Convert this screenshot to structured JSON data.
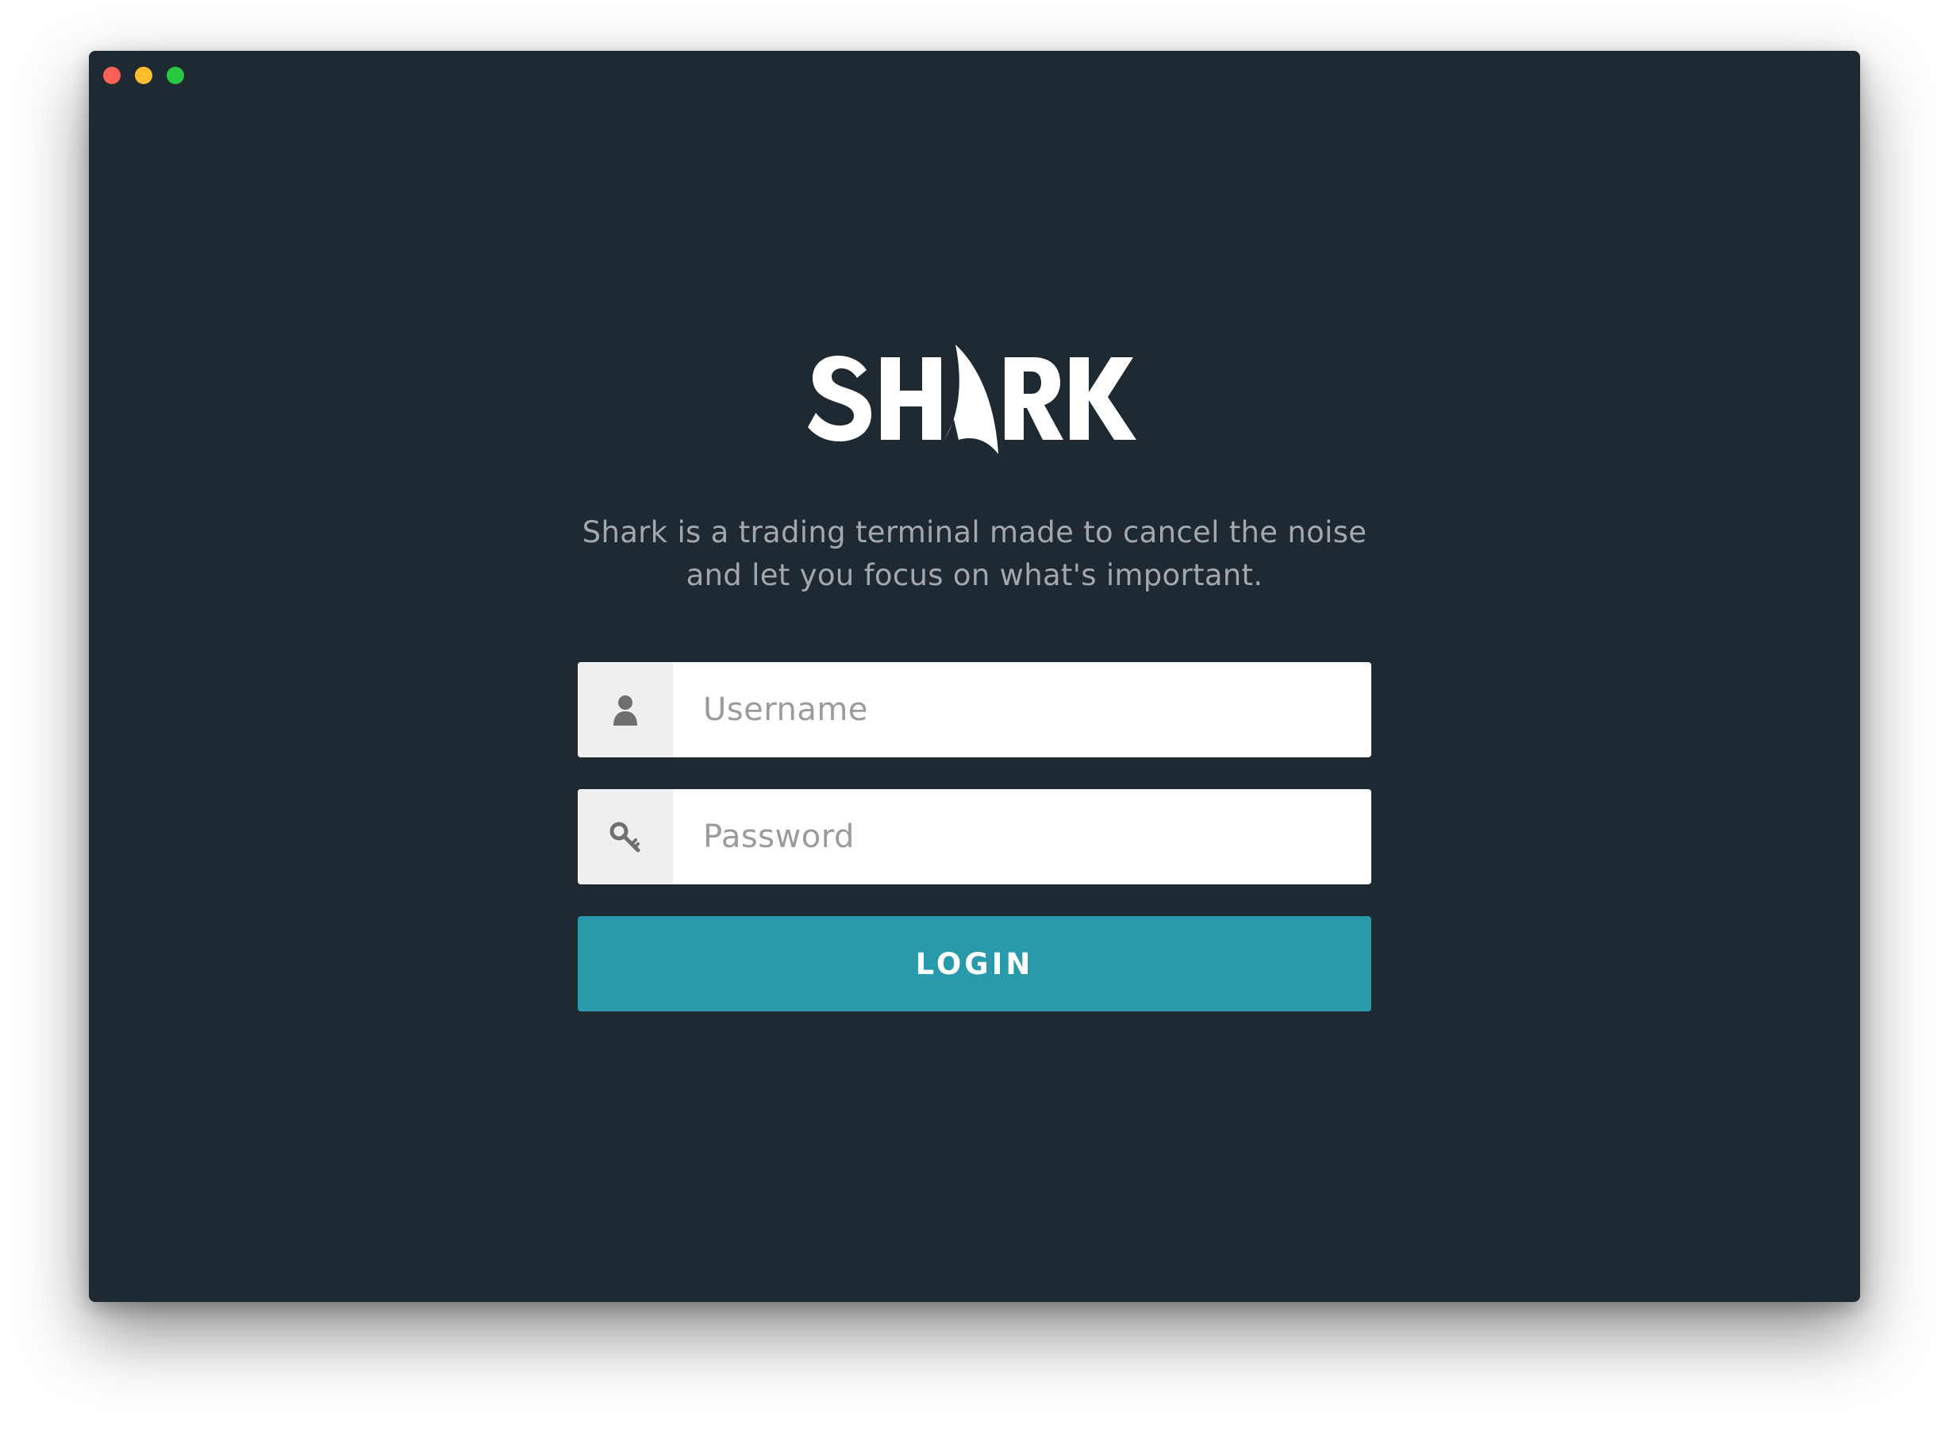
{
  "window": {
    "controls": [
      {
        "name": "close",
        "color": "#fe5f57"
      },
      {
        "name": "minimize",
        "color": "#febc2e"
      },
      {
        "name": "zoom",
        "color": "#28c840"
      }
    ]
  },
  "brand": {
    "logo_text": "SHARK",
    "logo_icon": "shark-fin-icon"
  },
  "tagline": {
    "line1": "Shark is a trading terminal made to cancel the noise",
    "line2": "and let you focus on what's important."
  },
  "form": {
    "username": {
      "value": "",
      "placeholder": "Username",
      "icon": "user-icon"
    },
    "password": {
      "value": "",
      "placeholder": "Password",
      "icon": "key-icon"
    },
    "login_label": "LOGIN"
  },
  "colors": {
    "background": "#1e2932",
    "accent": "#289aaa",
    "muted_text": "#a1a8ae"
  }
}
